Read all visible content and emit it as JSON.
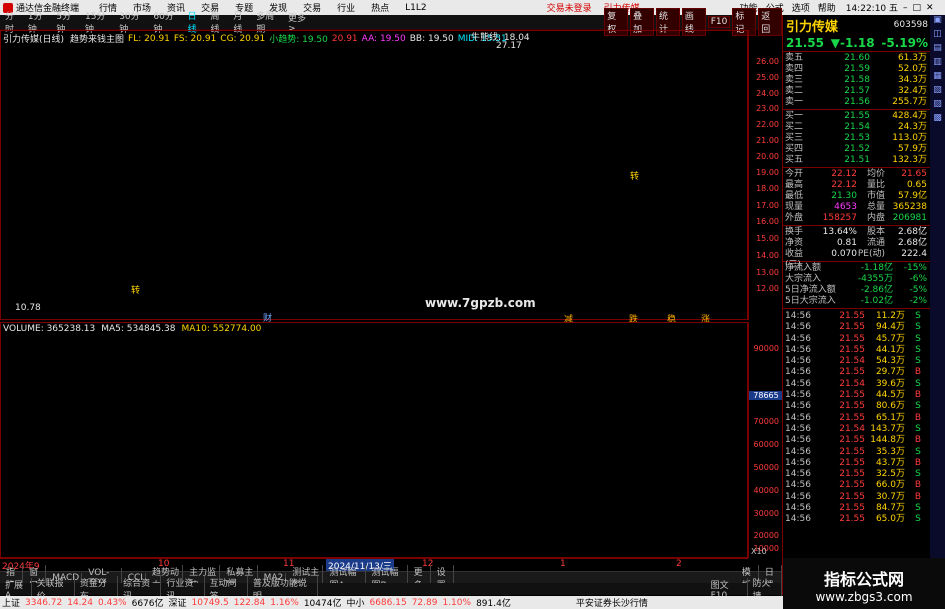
{
  "titlebar": {
    "app": "通达信金融终端",
    "menus": [
      "行情",
      "市场",
      "资讯",
      "交易",
      "专题",
      "发现",
      "交易",
      "行业",
      "热点",
      "L1L2"
    ],
    "alert1": "交易未登录",
    "alert2": "引力传媒",
    "right_menus": [
      "功能",
      "公式",
      "选项",
      "帮助"
    ],
    "time": "14:22:10 五"
  },
  "toolbar": {
    "periods": [
      "分时",
      "1分钟",
      "5分钟",
      "15分钟",
      "30分钟",
      "60分钟",
      "日线",
      "周线",
      "月线",
      "多周期",
      "更多 >"
    ],
    "active": "日线",
    "buttons": [
      "复权",
      "叠加",
      "统计",
      "画线",
      "F10",
      "标记",
      "返回"
    ]
  },
  "indicator": {
    "name": "引力传媒(日线)",
    "formula": "趋势来钱主图",
    "fl": "FL: 20.91",
    "fs": "FS: 20.91",
    "cg": "CG: 20.91",
    "xqs": "小趋势: 19.50",
    "v20": "20.91",
    "aa": "AA: 19.50",
    "bb": "BB: 19.50",
    "mid": "MID: 15.51",
    "high_label": "牛熊线: 18.04",
    "high": "27.17",
    "low": "10.78",
    "watermark_site": "www.7gpzb.com",
    "markers": [
      "财",
      "减",
      "跌",
      "稳",
      "涨"
    ],
    "marker_b1": "转",
    "marker_b2": "转"
  },
  "price_ticks": [
    "26.00",
    "25.00",
    "24.00",
    "23.00",
    "22.00",
    "21.00",
    "20.00",
    "19.00",
    "18.00",
    "17.00",
    "16.00",
    "15.00",
    "14.00",
    "13.00",
    "12.00"
  ],
  "volume": {
    "label": "VOLUME: 365238.13",
    "ma5": "MA5: 534845.38",
    "ma10": "MA10: 552774.00",
    "ticks": [
      "90000",
      "80000",
      "70000",
      "60000",
      "50000",
      "40000",
      "30000",
      "20000",
      "10000"
    ],
    "unit": "X10",
    "current": "78665",
    "dates": [
      "2024年9",
      "10",
      "11",
      "2024/11/13/三",
      "12",
      "1",
      "2"
    ]
  },
  "quote": {
    "name": "引力传媒",
    "code": "603598",
    "price": "21.55",
    "change": "▼-1.18",
    "pct": "-5.19%",
    "asks": [
      {
        "l": "卖五",
        "p": "21.60",
        "v": "61.3万"
      },
      {
        "l": "卖四",
        "p": "21.59",
        "v": "52.0万"
      },
      {
        "l": "卖三",
        "p": "21.58",
        "v": "34.3万"
      },
      {
        "l": "卖二",
        "p": "21.57",
        "v": "32.4万"
      },
      {
        "l": "卖一",
        "p": "21.56",
        "v": "255.7万"
      }
    ],
    "bids": [
      {
        "l": "买一",
        "p": "21.55",
        "v": "428.4万"
      },
      {
        "l": "买二",
        "p": "21.54",
        "v": "24.3万"
      },
      {
        "l": "买三",
        "p": "21.53",
        "v": "113.0万"
      },
      {
        "l": "买四",
        "p": "21.52",
        "v": "57.9万"
      },
      {
        "l": "买五",
        "p": "21.51",
        "v": "132.3万"
      }
    ],
    "stats": [
      {
        "l": "今开",
        "v": "22.12",
        "l2": "均价",
        "v2": "21.65"
      },
      {
        "l": "最高",
        "v": "22.12",
        "l2": "量比",
        "v2": "0.65"
      },
      {
        "l": "最低",
        "v": "21.30",
        "l2": "市值",
        "v2": "57.9亿"
      },
      {
        "l": "现量",
        "v": "4653",
        "l2": "总量",
        "v2": "365238"
      },
      {
        "l": "外盘",
        "v": "158257",
        "l2": "内盘",
        "v2": "206981"
      },
      {
        "l": "换手",
        "v": "13.64%",
        "l2": "股本",
        "v2": "2.68亿"
      },
      {
        "l": "净资",
        "v": "0.81",
        "l2": "流通",
        "v2": "2.68亿"
      },
      {
        "l": "收益(三)",
        "v": "0.070",
        "l2": "PE(动)",
        "v2": "222.4"
      }
    ],
    "flows": [
      {
        "l": "净流入额",
        "v": "-1.18亿",
        "p": "-15%"
      },
      {
        "l": "大宗流入",
        "v": "-4355万",
        "p": "-6%"
      },
      {
        "l": "5日净流入额",
        "v": "-2.86亿",
        "p": "-5%"
      },
      {
        "l": "5日大宗流入",
        "v": "-1.02亿",
        "p": "-2%"
      }
    ],
    "ticks": [
      {
        "t": "14:56",
        "p": "21.55",
        "v": "11.2万",
        "f": "S"
      },
      {
        "t": "14:56",
        "p": "21.55",
        "v": "94.4万",
        "f": "S"
      },
      {
        "t": "14:56",
        "p": "21.55",
        "v": "45.7万",
        "f": "S"
      },
      {
        "t": "14:56",
        "p": "21.55",
        "v": "44.1万",
        "f": "S"
      },
      {
        "t": "14:56",
        "p": "21.54",
        "v": "54.3万",
        "f": "S"
      },
      {
        "t": "14:56",
        "p": "21.55",
        "v": "29.7万",
        "f": "B"
      },
      {
        "t": "14:56",
        "p": "21.54",
        "v": "39.6万",
        "f": "S"
      },
      {
        "t": "14:56",
        "p": "21.55",
        "v": "44.5万",
        "f": "B"
      },
      {
        "t": "14:56",
        "p": "21.55",
        "v": "80.6万",
        "f": "S"
      },
      {
        "t": "14:56",
        "p": "21.55",
        "v": "65.1万",
        "f": "B"
      },
      {
        "t": "14:56",
        "p": "21.54",
        "v": "143.7万",
        "f": "S"
      },
      {
        "t": "14:56",
        "p": "21.55",
        "v": "144.8万",
        "f": "B"
      },
      {
        "t": "14:56",
        "p": "21.55",
        "v": "35.3万",
        "f": "S"
      },
      {
        "t": "14:56",
        "p": "21.55",
        "v": "43.7万",
        "f": "B"
      },
      {
        "t": "14:56",
        "p": "21.55",
        "v": "32.5万",
        "f": "S"
      },
      {
        "t": "14:56",
        "p": "21.55",
        "v": "66.0万",
        "f": "B"
      },
      {
        "t": "14:56",
        "p": "21.55",
        "v": "30.7万",
        "f": "B"
      },
      {
        "t": "14:56",
        "p": "21.55",
        "v": "84.7万",
        "f": "S"
      },
      {
        "t": "14:56",
        "p": "21.55",
        "v": "65.0万",
        "f": "S"
      }
    ]
  },
  "tabs": [
    "指标",
    "窗口",
    "MACD",
    "VOL-TDX",
    "CCI",
    "趋势动力",
    "主力监控",
    "私募主图",
    "MA2",
    "测试主图",
    "测试幅图A",
    "测试幅图B",
    "更多",
    "设置"
  ],
  "tabs_right": [
    "模板",
    "日线"
  ],
  "tabs2": [
    "扩展A",
    "关联报价",
    "资金分布",
    "综合资讯",
    "行业资讯",
    "互动问答",
    "普及版功能说明"
  ],
  "tabs2_right": "图文F10",
  "tabs2_right2": "防火墙",
  "status": {
    "sh_label": "上证",
    "sh": "3346.72",
    "sh_ch": "14.24",
    "sh_pct": "0.43%",
    "sh_amt": "6676亿",
    "sz_label": "深证",
    "sz": "10749.5",
    "sz_ch": "122.84",
    "sz_pct": "1.16%",
    "sz_amt": "10474亿",
    "zx_label": "中小",
    "zx": "6686.15",
    "zx_ch": "72.89",
    "zx_pct": "1.10%",
    "zx_amt": "891.4亿",
    "broker": "平安证券长沙行情"
  },
  "watermark": {
    "title": "指标公式网",
    "url": "www.zbgs3.com"
  }
}
